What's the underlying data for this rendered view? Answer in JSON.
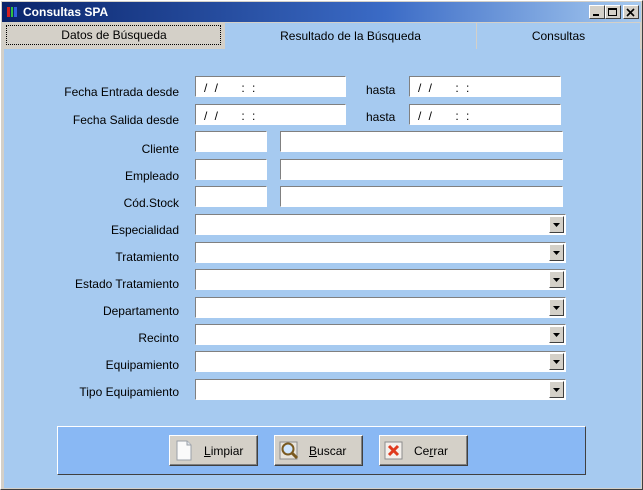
{
  "window": {
    "title": "Consultas SPA"
  },
  "tabs": [
    {
      "label": "Datos de Búsqueda",
      "active": true
    },
    {
      "label": "Resultado de la Búsqueda",
      "active": false
    },
    {
      "label": "Consultas",
      "active": false
    }
  ],
  "form": {
    "fecha_entrada": {
      "label": "Fecha Entrada desde",
      "from_value": "/ /    : :",
      "to_label": "hasta",
      "to_value": "/ /    : :"
    },
    "fecha_salida": {
      "label": "Fecha Salida desde",
      "from_value": "/ /    : :",
      "to_label": "hasta",
      "to_value": "/ /    : :"
    },
    "cliente": {
      "label": "Cliente",
      "code": "",
      "name": ""
    },
    "empleado": {
      "label": "Empleado",
      "code": "",
      "name": ""
    },
    "cod_stock": {
      "label": "Cód.Stock",
      "code": "",
      "name": ""
    },
    "combos": [
      {
        "label": "Especialidad",
        "value": ""
      },
      {
        "label": "Tratamiento",
        "value": ""
      },
      {
        "label": "Estado Tratamiento",
        "value": ""
      },
      {
        "label": "Departamento",
        "value": ""
      },
      {
        "label": "Recinto",
        "value": ""
      },
      {
        "label": "Equipamiento",
        "value": ""
      },
      {
        "label": "Tipo Equipamiento",
        "value": ""
      }
    ]
  },
  "buttons": {
    "limpiar": {
      "mnemonic": "L",
      "rest": "impiar",
      "icon": "blank-page-icon"
    },
    "buscar": {
      "mnemonic": "B",
      "rest": "uscar",
      "icon": "magnifier-icon"
    },
    "cerrar": {
      "pre": "Ce",
      "mnemonic": "r",
      "rest": "rar",
      "icon": "close-x-icon"
    }
  },
  "colors": {
    "titlebar_start": "#0a246a",
    "titlebar_end": "#a6caf0",
    "panel": "#a6caf0",
    "button_bar": "#89b8f4",
    "face": "#d4d0c8"
  }
}
